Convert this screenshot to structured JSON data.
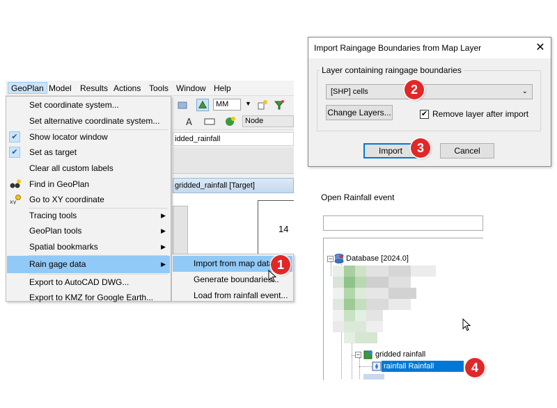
{
  "menubar": {
    "items": [
      "GeoPlan",
      "Model",
      "Results",
      "Actions",
      "Tools",
      "Window",
      "Help"
    ]
  },
  "toolbar": {
    "units_value": "MM",
    "node_value": "Node",
    "address_text": "idded_rainfall"
  },
  "geoplan_window": {
    "title": "gridded_rainfall [Target]",
    "map_label": "14"
  },
  "geoplan_menu": {
    "items": [
      {
        "label": "Set coordinate system...",
        "checked": false,
        "submenu": false
      },
      {
        "label": "Set alternative coordinate system...",
        "checked": false,
        "submenu": false
      },
      {
        "label": "Show locator window",
        "checked": true,
        "submenu": false
      },
      {
        "label": "Set as target",
        "checked": true,
        "submenu": false
      },
      {
        "label": "Clear all custom labels",
        "checked": false,
        "submenu": false
      },
      {
        "label": "Find in GeoPlan",
        "checked": false,
        "submenu": false,
        "icon": "binoculars-icon"
      },
      {
        "label": "Go to XY coordinate",
        "checked": false,
        "submenu": false,
        "icon": "xy-pin-icon"
      },
      {
        "label": "Tracing tools",
        "checked": false,
        "submenu": true
      },
      {
        "label": "GeoPlan tools",
        "checked": false,
        "submenu": true
      },
      {
        "label": "Spatial bookmarks",
        "checked": false,
        "submenu": true
      },
      {
        "label": "Rain gage data",
        "checked": false,
        "submenu": true,
        "highlighted": true
      },
      {
        "label": "Export to AutoCAD DWG...",
        "checked": false,
        "submenu": false
      },
      {
        "label": "Export to KMZ for Google Earth...",
        "checked": false,
        "submenu": false
      }
    ]
  },
  "rain_gage_submenu": {
    "items": [
      {
        "label": "Import from map data...",
        "highlighted": true
      },
      {
        "label": "Generate boundaries..."
      },
      {
        "label": "Load from rainfall event..."
      }
    ]
  },
  "dialog": {
    "title": "Import Raingage Boundaries from Map Layer",
    "close_glyph": "✕",
    "group_label": "Layer containing raingage boundaries",
    "layer_value": "[SHP] cells",
    "change_layers_label": "Change Layers...",
    "remove_layer_label": "Remove layer after import",
    "remove_layer_checked": true,
    "import_label": "Import",
    "cancel_label": "Cancel"
  },
  "open_rainfall_event": {
    "label": "Open Rainfall event",
    "search_value": "",
    "tree": {
      "root": "Database [2024.0]",
      "group": "gridded rainfall",
      "selected_item": "rainfall Rainfall intensity"
    }
  },
  "step_badges": [
    "1",
    "2",
    "3",
    "4"
  ],
  "colors": {
    "menu_highlight": "#91c9f7",
    "badge_red": "#e02828",
    "selection_blue": "#0078d7",
    "default_button_border": "#0078d7"
  }
}
